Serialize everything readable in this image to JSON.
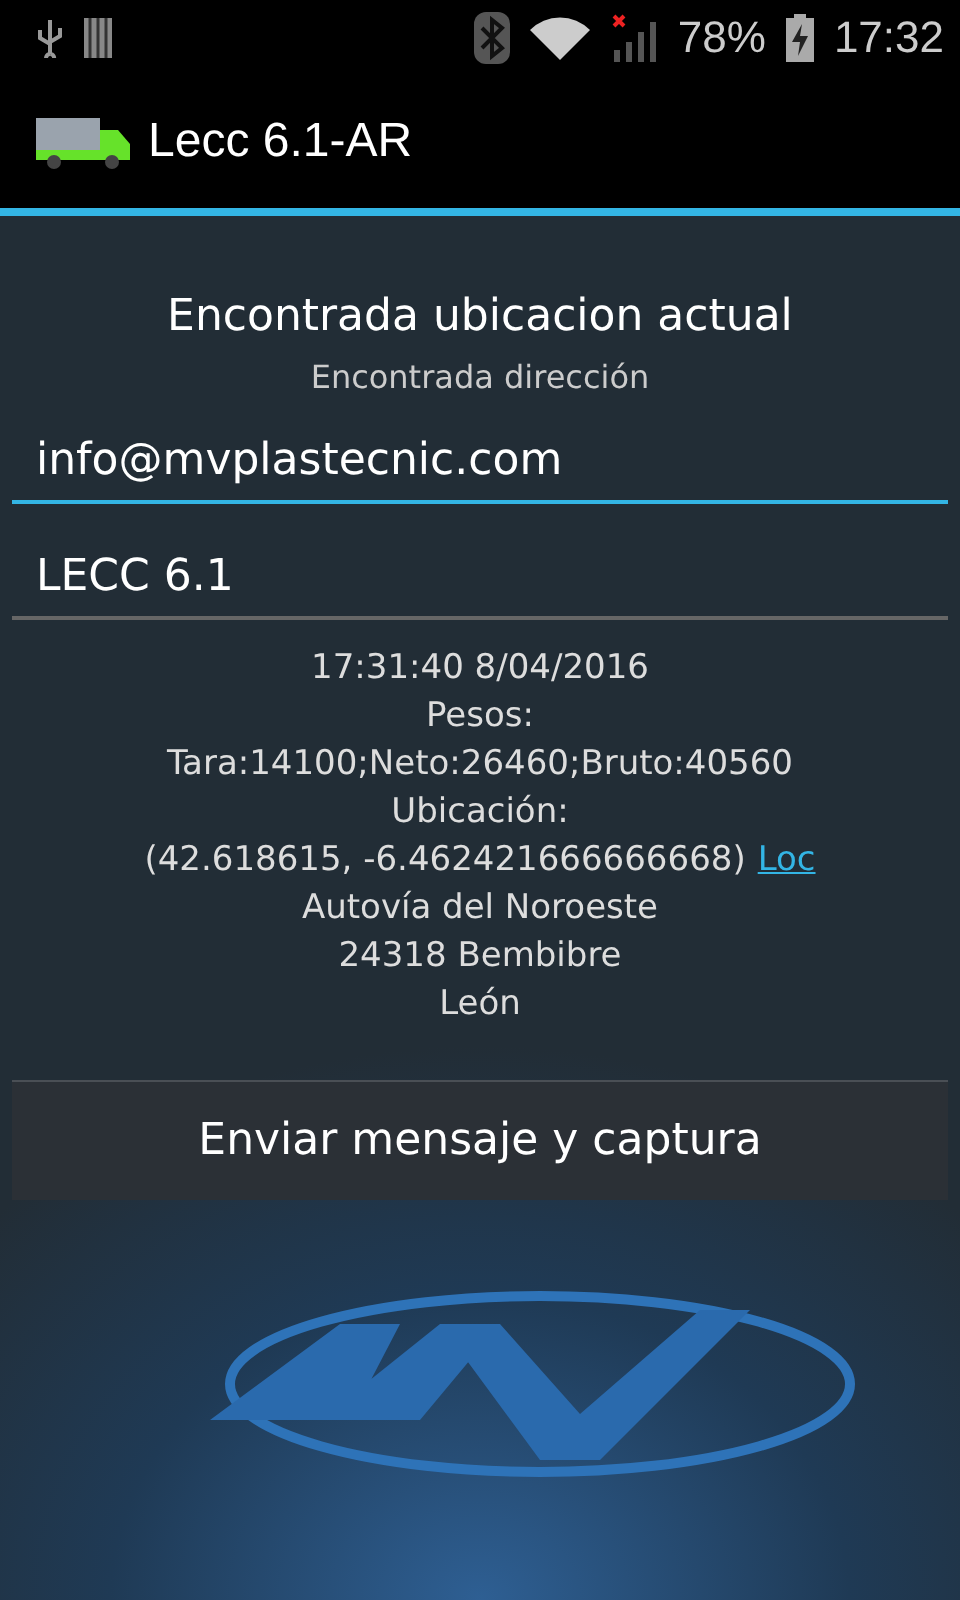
{
  "status_bar": {
    "battery": "78%",
    "time": "17:32"
  },
  "app_bar": {
    "title": "Lecc 6.1-AR"
  },
  "header": {
    "title": "Encontrada ubicacion actual",
    "subtitle": "Encontrada dirección"
  },
  "fields": [
    {
      "value": "info@mvplastecnic.com",
      "focused": true
    },
    {
      "value": "LECC 6.1",
      "focused": false
    }
  ],
  "info_lines": [
    {
      "text": "17:31:40 8/04/2016"
    },
    {
      "text": "Pesos:"
    },
    {
      "text": "Tara:14100;Neto:26460;Bruto:40560"
    },
    {
      "text": "Ubicación:"
    },
    {
      "text": "(42.618615, -6.462421666666668)",
      "link": "Loc"
    },
    {
      "text": "Autovía del Noroeste"
    },
    {
      "text": "24318 Bembibre"
    },
    {
      "text": "León"
    }
  ],
  "send_button": {
    "label": "Enviar mensaje y captura"
  }
}
